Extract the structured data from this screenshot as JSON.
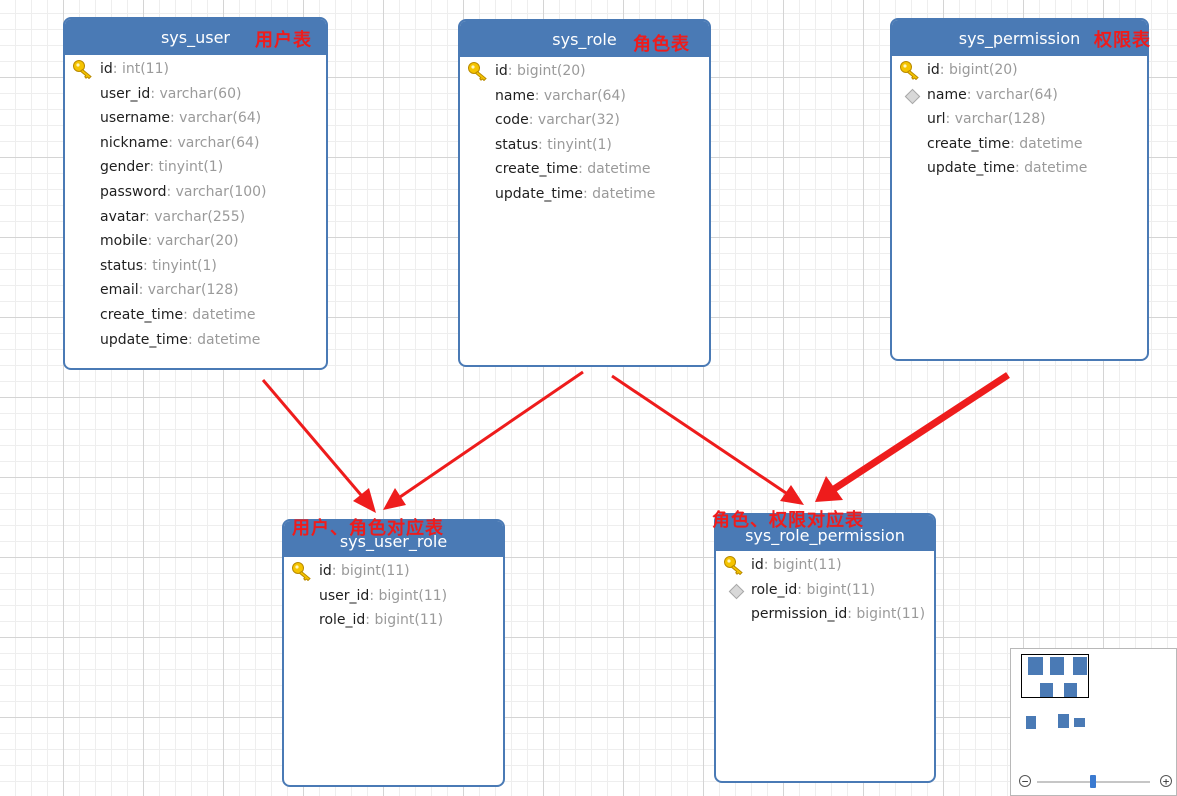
{
  "colors": {
    "header": "#4a7ab5",
    "annotation": "#ee1c1c",
    "key_icon": "#f0b800"
  },
  "tables": {
    "sys_user": {
      "title": "sys_user",
      "annotation": "用户表",
      "fields": [
        {
          "name": "id",
          "type": ": int(11)",
          "icon": "key-icon"
        },
        {
          "name": "user_id",
          "type": ": varchar(60)"
        },
        {
          "name": "username",
          "type": ": varchar(64)"
        },
        {
          "name": "nickname",
          "type": ": varchar(64)"
        },
        {
          "name": "gender",
          "type": ": tinyint(1)"
        },
        {
          "name": "password",
          "type": ": varchar(100)"
        },
        {
          "name": "avatar",
          "type": ": varchar(255)"
        },
        {
          "name": "mobile",
          "type": ": varchar(20)"
        },
        {
          "name": "status",
          "type": ": tinyint(1)"
        },
        {
          "name": "email",
          "type": ": varchar(128)"
        },
        {
          "name": "create_time",
          "type": ": datetime"
        },
        {
          "name": "update_time",
          "type": ": datetime"
        }
      ]
    },
    "sys_role": {
      "title": "sys_role",
      "annotation": "角色表",
      "fields": [
        {
          "name": "id",
          "type": ": bigint(20)",
          "icon": "key-icon"
        },
        {
          "name": "name",
          "type": ": varchar(64)"
        },
        {
          "name": "code",
          "type": ": varchar(32)"
        },
        {
          "name": "status",
          "type": ": tinyint(1)"
        },
        {
          "name": "create_time",
          "type": ": datetime"
        },
        {
          "name": "update_time",
          "type": ": datetime"
        }
      ]
    },
    "sys_permission": {
      "title": "sys_permission",
      "annotation": "权限表",
      "fields": [
        {
          "name": "id",
          "type": ": bigint(20)",
          "icon": "key-icon"
        },
        {
          "name": "name",
          "type": ": varchar(64)",
          "icon": "index-diamond-icon"
        },
        {
          "name": "url",
          "type": ": varchar(128)"
        },
        {
          "name": "create_time",
          "type": ": datetime"
        },
        {
          "name": "update_time",
          "type": ": datetime"
        }
      ]
    },
    "sys_user_role": {
      "title": "sys_user_role",
      "annotation": "用户、角色对应表",
      "fields": [
        {
          "name": "id",
          "type": ": bigint(11)",
          "icon": "key-icon"
        },
        {
          "name": "user_id",
          "type": ": bigint(11)"
        },
        {
          "name": "role_id",
          "type": ": bigint(11)"
        }
      ]
    },
    "sys_role_permission": {
      "title": "sys_role_permission",
      "annotation": "角色、权限对应表",
      "fields": [
        {
          "name": "id",
          "type": ": bigint(11)",
          "icon": "key-icon"
        },
        {
          "name": "role_id",
          "type": ": bigint(11)",
          "icon": "index-diamond-icon"
        },
        {
          "name": "permission_id",
          "type": ": bigint(11)"
        }
      ]
    }
  },
  "zoom": {
    "out_label": "−",
    "in_label": "+"
  }
}
